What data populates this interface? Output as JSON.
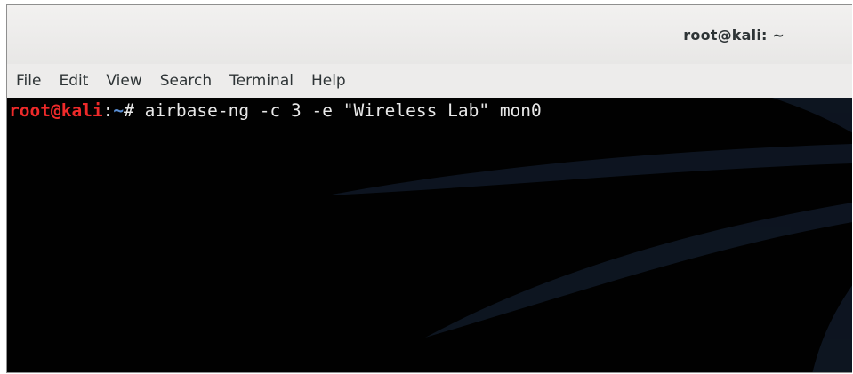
{
  "window": {
    "title": "root@kali: ~"
  },
  "menu": {
    "items": [
      "File",
      "Edit",
      "View",
      "Search",
      "Terminal",
      "Help"
    ]
  },
  "terminal": {
    "prompt_user": "root@kali",
    "prompt_colon": ":",
    "prompt_path": "~",
    "prompt_symbol": "# ",
    "command": "airbase-ng -c 3 -e \"Wireless Lab\" mon0"
  },
  "colors": {
    "prompt_user": "#ee2a2a",
    "prompt_path": "#5a8fd6",
    "terminal_bg": "#010101",
    "text": "#e8e8e8"
  }
}
